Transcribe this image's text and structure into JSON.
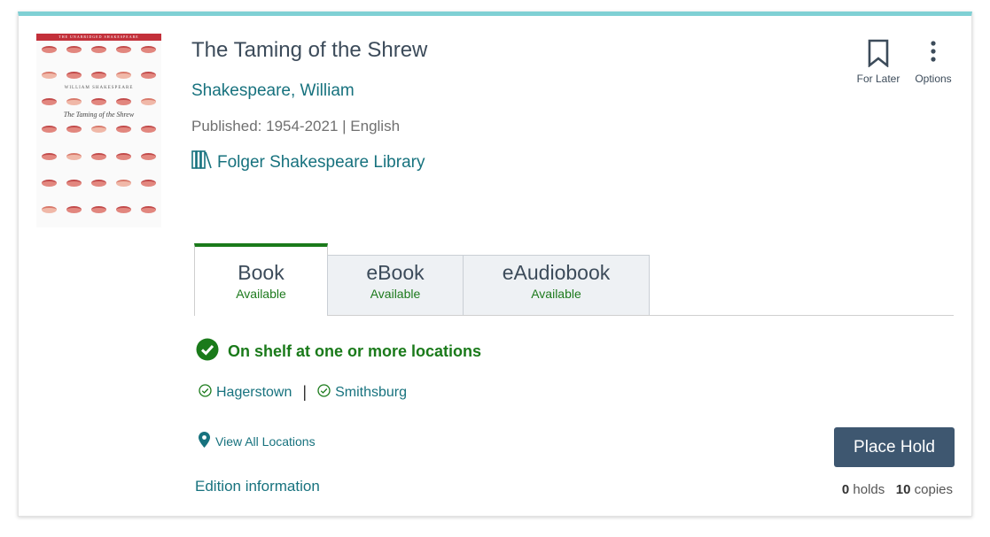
{
  "book": {
    "title": "The Taming of the Shrew",
    "author": "Shakespeare, William",
    "published": "Published: 1954-2021 | English",
    "collection": "Folger Shakespeare Library"
  },
  "cover": {
    "band_text": "THE UNABRIDGED SHAKESPEARE",
    "author_text": "WILLIAM SHAKESPEARE",
    "title_text": "The Taming of the Shrew"
  },
  "actions": {
    "for_later": "For Later",
    "options": "Options"
  },
  "tabs": [
    {
      "label": "Book",
      "status": "Available",
      "active": true
    },
    {
      "label": "eBook",
      "status": "Available",
      "active": false
    },
    {
      "label": "eAudiobook",
      "status": "Available",
      "active": false
    }
  ],
  "availability": {
    "status": "On shelf at one or more locations",
    "locations": [
      "Hagerstown",
      "Smithsburg"
    ],
    "view_all": "View All Locations"
  },
  "edition_info": "Edition information",
  "place_hold": "Place Hold",
  "counts": {
    "holds_count": "0",
    "holds_label": "holds",
    "copies_count": "10",
    "copies_label": "copies"
  },
  "colors": {
    "accent_top": "#7fd0d4",
    "link": "#17727e",
    "available_green": "#1a7a1a",
    "button": "#3e5770"
  }
}
